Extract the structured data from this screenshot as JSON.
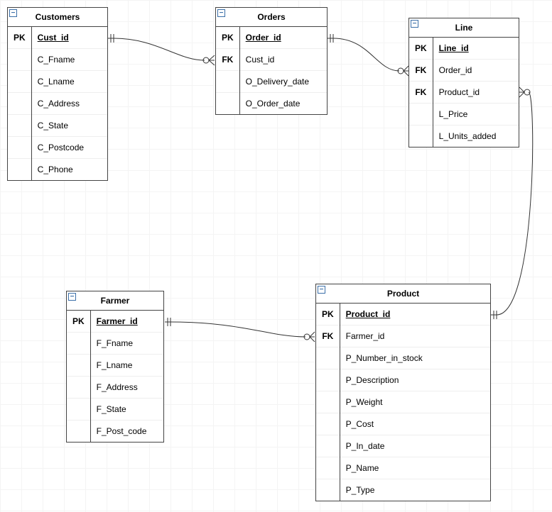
{
  "entities": {
    "customers": {
      "title": "Customers",
      "key_labels": [
        "PK",
        "",
        "",
        "",
        "",
        "",
        ""
      ],
      "fields": [
        "Cust_id",
        "C_Fname",
        "C_Lname",
        "C_Address",
        "C_State",
        "C_Postcode",
        "C_Phone"
      ]
    },
    "orders": {
      "title": "Orders",
      "key_labels": [
        "PK",
        "FK",
        "",
        ""
      ],
      "fields": [
        "Order_id",
        "Cust_id",
        "O_Delivery_date",
        "O_Order_date"
      ]
    },
    "line": {
      "title": "Line",
      "key_labels": [
        "PK",
        "FK",
        "FK",
        "",
        ""
      ],
      "fields": [
        "Line_id",
        "Order_id",
        "Product_id",
        "L_Price",
        "L_Units_added"
      ]
    },
    "farmer": {
      "title": "Farmer",
      "key_labels": [
        "PK",
        "",
        "",
        "",
        "",
        ""
      ],
      "fields": [
        "Farmer_id",
        "F_Fname",
        "F_Lname",
        "F_Address",
        "F_State",
        "F_Post_code"
      ]
    },
    "product": {
      "title": "Product",
      "key_labels": [
        "PK",
        "FK",
        "",
        "",
        "",
        "",
        "",
        "",
        ""
      ],
      "fields": [
        "Product_id",
        "Farmer_id",
        "P_Number_in_stock",
        "P_Description",
        "P_Weight",
        "P_Cost",
        "P_In_date",
        "P_Name",
        "P_Type"
      ]
    }
  },
  "relationships": [
    {
      "from": "customers.Cust_id",
      "to": "orders.Cust_id",
      "cardinality": "one-to-many"
    },
    {
      "from": "orders.Order_id",
      "to": "line.Order_id",
      "cardinality": "one-to-many"
    },
    {
      "from": "product.Product_id",
      "to": "line.Product_id",
      "cardinality": "one-to-many"
    },
    {
      "from": "farmer.Farmer_id",
      "to": "product.Farmer_id",
      "cardinality": "one-to-many"
    }
  ],
  "collapse_glyph": "−"
}
